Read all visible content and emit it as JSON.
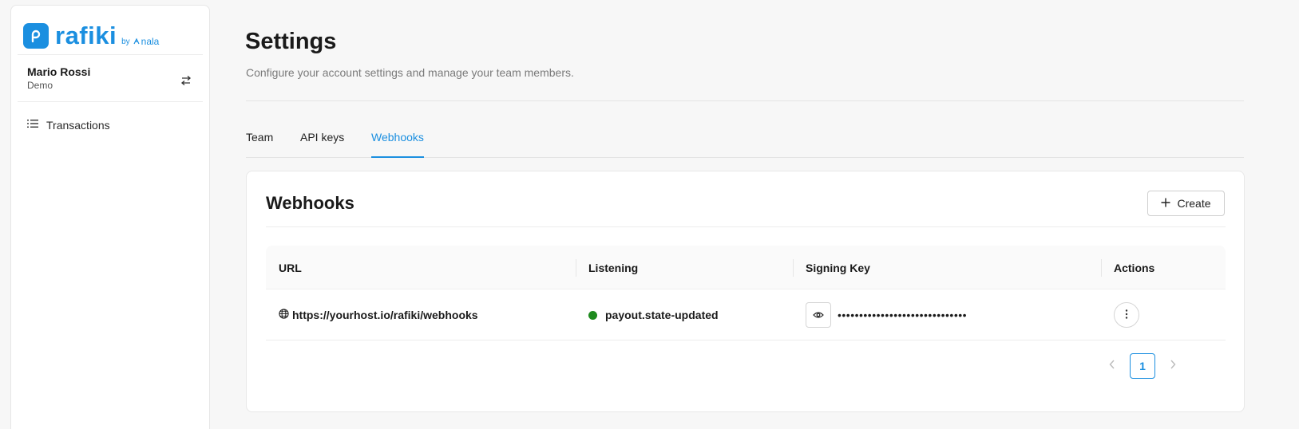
{
  "brand": {
    "name": "rafiki",
    "by": "by",
    "partner": "nala",
    "color": "#1b8fe0"
  },
  "user": {
    "name": "Mario Rossi",
    "org": "Demo"
  },
  "sidebar": {
    "items": [
      {
        "label": "Transactions",
        "icon": "list-icon"
      }
    ]
  },
  "page": {
    "title": "Settings",
    "subtitle": "Configure your account settings and manage your team members."
  },
  "tabs": [
    {
      "label": "Team",
      "active": false
    },
    {
      "label": "API keys",
      "active": false
    },
    {
      "label": "Webhooks",
      "active": true
    }
  ],
  "card": {
    "title": "Webhooks",
    "create_label": "Create"
  },
  "table": {
    "columns": [
      "URL",
      "Listening",
      "Signing Key",
      "Actions"
    ],
    "rows": [
      {
        "url": "https://yourhost.io/rafiki/webhooks",
        "event": "payout.state-updated",
        "status_color": "#1e8a1e",
        "signing_key_masked": "••••••••••••••••••••••••••••••"
      }
    ]
  },
  "pagination": {
    "current_page": "1"
  },
  "colors": {
    "accent": "#1b8fe0",
    "status_active": "#1e8a1e"
  }
}
